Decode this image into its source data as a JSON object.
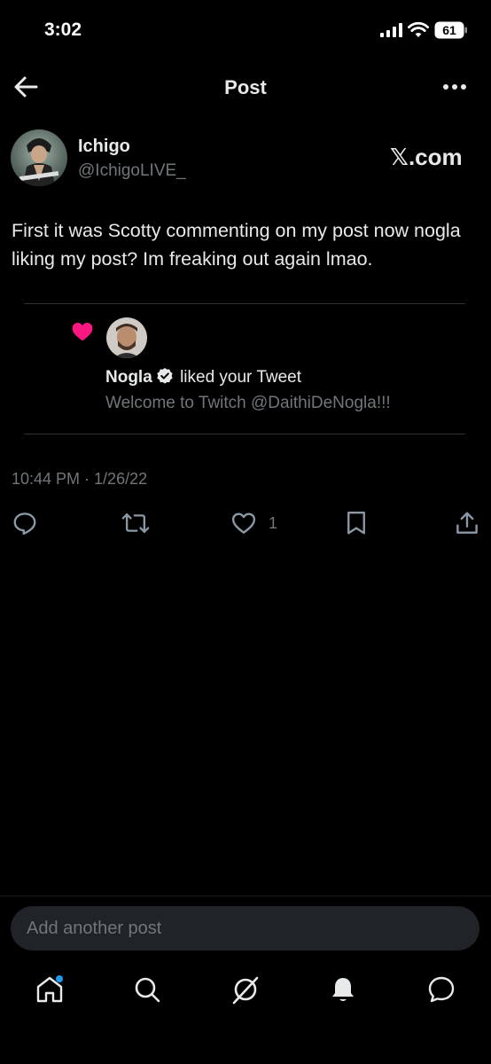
{
  "status_bar": {
    "time": "3:02",
    "battery": "61"
  },
  "header": {
    "title": "Post",
    "back_icon": "arrow-left-icon",
    "more_icon": "more-horizontal-icon"
  },
  "post": {
    "author_name": "Ichigo",
    "author_handle": "@IchigoLIVE_",
    "brand_label": "𝕏.com",
    "text": "First it was Scotty commenting on my post now nogla liking my post? Im freaking out again lmao.",
    "embedded_notification": {
      "liker_name": "Nogla",
      "action_text": "liked your Tweet",
      "tweet_text": "Welcome to Twitch @DaithiDeNogla!!!",
      "heart_color": "#f91880"
    },
    "timestamp": "10:44 PM · 1/26/22",
    "like_count": "1"
  },
  "compose": {
    "placeholder": "Add another post"
  },
  "bottom_nav": [
    "home-icon",
    "search-icon",
    "grok-icon",
    "notifications-icon",
    "messages-icon"
  ],
  "colors": {
    "background": "#000000",
    "text": "#e7e9ea",
    "secondary": "#71767b",
    "accent": "#1d9bf0"
  }
}
